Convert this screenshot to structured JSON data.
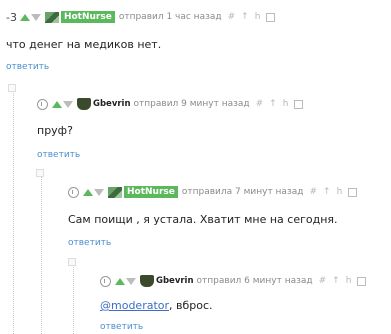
{
  "comments": [
    {
      "score": "-3",
      "author": "HotNurse",
      "meta": "отправил 1 час назад",
      "actions": [
        "#",
        "↑",
        "h"
      ],
      "text": "что денег на медиков нет.",
      "reply": "ответить"
    },
    {
      "author": "Gbevrin",
      "meta": "отправил 9 минут назад",
      "actions": [
        "#",
        "↑",
        "h"
      ],
      "text": "пруф?",
      "reply": "ответить"
    },
    {
      "author": "HotNurse",
      "meta": "отправила 7 минут назад",
      "actions": [
        "#",
        "↑",
        "h"
      ],
      "text": "Сам поищи , я устала. Хватит мне на сегодня.",
      "reply": "ответить"
    },
    {
      "author": "Gbevrin",
      "meta": "отправил 6 минут назад",
      "actions": [
        "#",
        "↑",
        "h"
      ],
      "mention": "@moderator",
      "text": ", вброс.",
      "reply": "ответить"
    }
  ]
}
